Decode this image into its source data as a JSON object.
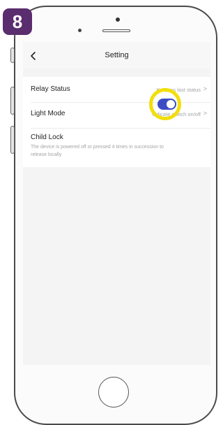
{
  "step_badge": "8",
  "nav": {
    "back_icon": "chevron-left-icon",
    "title": "Setting"
  },
  "settings": {
    "relay_status": {
      "label": "Relay Status",
      "value": "Keep as last status",
      "chevron": ">"
    },
    "light_mode": {
      "label": "Light Mode",
      "value": "Indicate switch on/off",
      "chevron": ">"
    },
    "child_lock": {
      "label": "Child Lock",
      "description": "The device is powered off or pressed 4 times in succession to release locally",
      "enabled": true
    }
  },
  "colors": {
    "badge": "#5a2d6e",
    "toggle_on": "#3a4dc4",
    "highlight_ring": "#f2de0c"
  }
}
